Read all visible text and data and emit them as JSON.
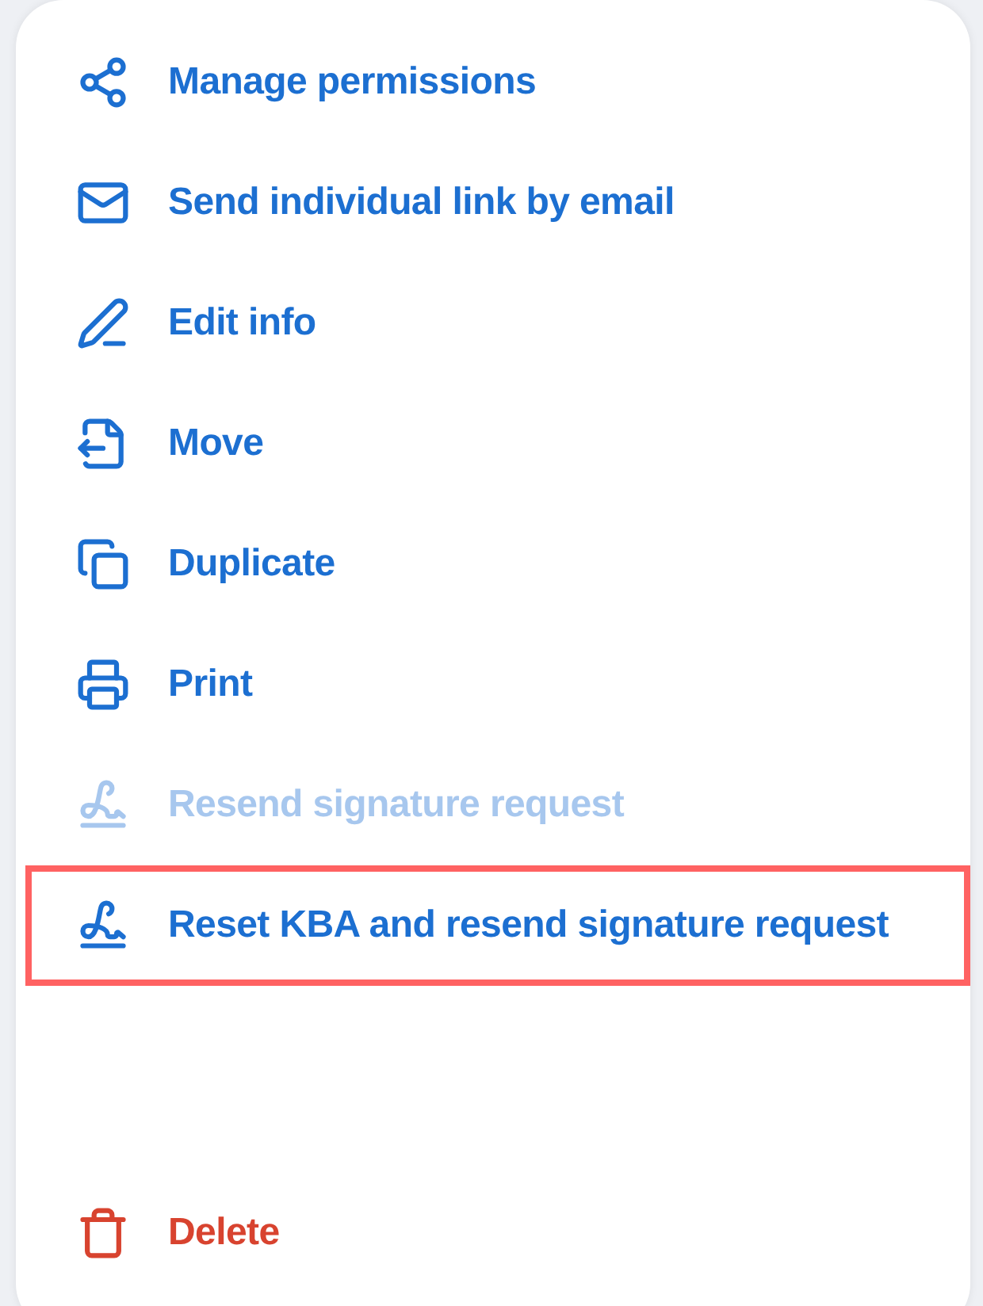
{
  "menu": {
    "items": [
      {
        "label": "Manage permissions",
        "kind": "action",
        "disabled": false,
        "highlighted": false
      },
      {
        "label": "Send individual link by email",
        "kind": "action",
        "disabled": false,
        "highlighted": false
      },
      {
        "label": "Edit info",
        "kind": "action",
        "disabled": false,
        "highlighted": false
      },
      {
        "label": "Move",
        "kind": "action",
        "disabled": false,
        "highlighted": false
      },
      {
        "label": "Duplicate",
        "kind": "action",
        "disabled": false,
        "highlighted": false
      },
      {
        "label": "Print",
        "kind": "action",
        "disabled": false,
        "highlighted": false
      },
      {
        "label": "Resend signature request",
        "kind": "action",
        "disabled": true,
        "highlighted": false
      },
      {
        "label": "Reset KBA and resend signature request",
        "kind": "action",
        "disabled": false,
        "highlighted": true
      },
      {
        "label": "Delete",
        "kind": "danger",
        "disabled": false,
        "highlighted": false
      }
    ]
  }
}
